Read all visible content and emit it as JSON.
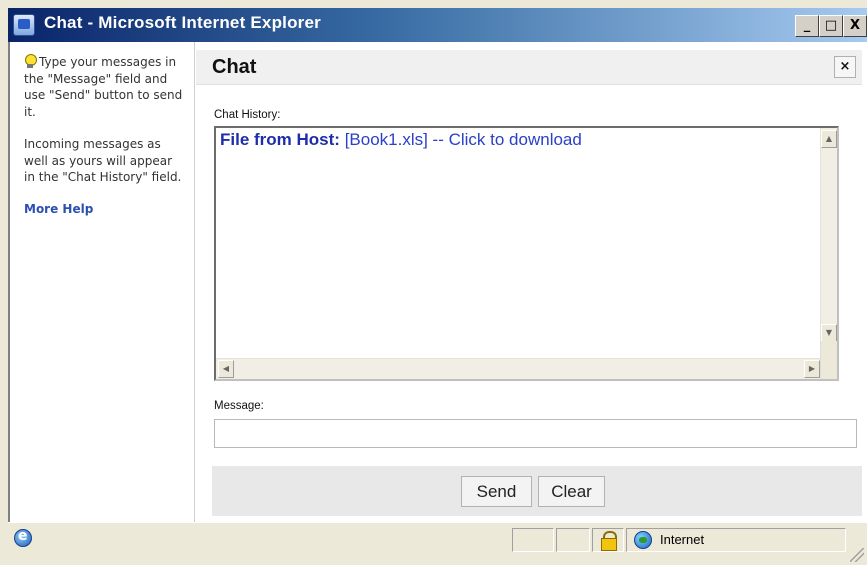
{
  "window": {
    "title": "Chat - Microsoft Internet Explorer",
    "minimize_label": "_",
    "maximize_label": "□",
    "close_label": "X"
  },
  "help": {
    "para1": "Type your messages in the \"Message\" field and use \"Send\" button to send it.",
    "para2": "Incoming messages as well as yours will appear in the \"Chat History\" field.",
    "more_help": "More Help"
  },
  "chat": {
    "title": "Chat",
    "close_label": "×",
    "history_label": "Chat History:",
    "history": [
      {
        "sender": "File from Host:",
        "text": "[Book1.xls] -- Click to download"
      }
    ],
    "message_label": "Message:",
    "message_value": "",
    "send_label": "Send",
    "clear_label": "Clear"
  },
  "statusbar": {
    "zone": "Internet"
  },
  "colors": {
    "title_gradient_start": "#0a246a",
    "link_blue": "#2a40c8"
  }
}
